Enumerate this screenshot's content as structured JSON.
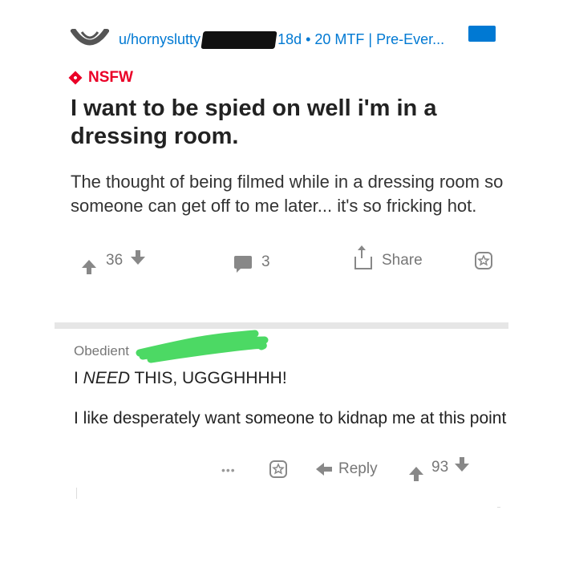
{
  "post": {
    "author": "u/hornyslutty",
    "meta": "18d • 20 MTF | Pre-Ever...",
    "flair": "NSFW",
    "title": "I want to be spied on well i'm in a dressing room.",
    "body": "The thought of being filmed while in a dressing room so someone can get off to me later... it's so fricking hot.",
    "score": "36",
    "comments": "3",
    "share_label": "Share"
  },
  "comment": {
    "author": "Obedient",
    "head_prefix": "I ",
    "head_emph": "NEED",
    "head_suffix": " THIS, UGGGHHHH!",
    "body": "I like desperately want someone to kidnap me at this point",
    "more_label": "•••",
    "reply_label": "Reply",
    "score": "93"
  },
  "colors": {
    "accent": "#0079d3",
    "nsfw": "#ea0027",
    "scribble": "#4cd964",
    "icon_gray": "#888888"
  },
  "icons": [
    "subreddit-icon",
    "save-badge-icon",
    "nsfw-icon",
    "upvote-icon",
    "downvote-icon",
    "comment-icon",
    "share-icon",
    "gold-icon",
    "more-icon",
    "reply-icon"
  ]
}
